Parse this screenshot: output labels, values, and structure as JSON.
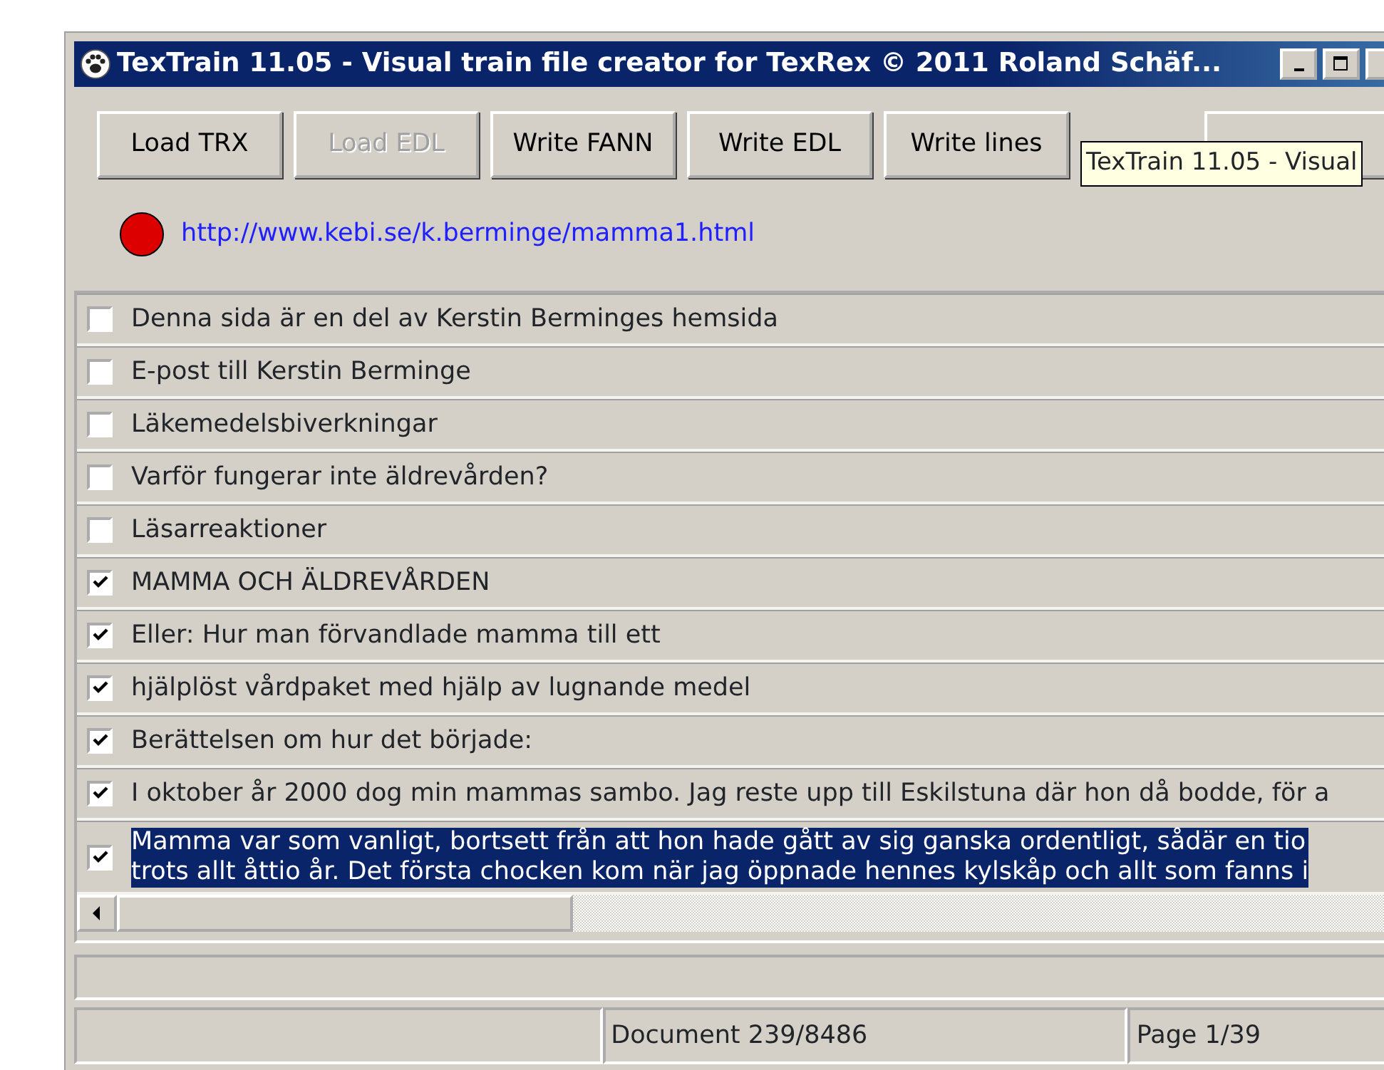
{
  "window": {
    "title": "TexTrain 11.05 - Visual train file creator for TexRex © 2011 Roland Schäf..."
  },
  "toolbar": [
    {
      "label": "Load TRX",
      "disabled": false
    },
    {
      "label": "Load EDL",
      "disabled": true
    },
    {
      "label": "Write FANN",
      "disabled": false
    },
    {
      "label": "Write EDL",
      "disabled": false
    },
    {
      "label": "Write lines",
      "disabled": false
    }
  ],
  "tooltip": "TexTrain 11.05 - Visual",
  "status_light": {
    "color": "#dd0000"
  },
  "url": "http://www.kebi.se/k.berminge/mamma1.html",
  "lines": [
    {
      "text": "Denna sida är en del av Kerstin Berminges hemsida",
      "checked": false,
      "selected": false
    },
    {
      "text": "E-post till Kerstin Berminge",
      "checked": false,
      "selected": false
    },
    {
      "text": "Läkemedelsbiverkningar",
      "checked": false,
      "selected": false
    },
    {
      "text": "Varför fungerar inte äldrevården?",
      "checked": false,
      "selected": false
    },
    {
      "text": "Läsarreaktioner",
      "checked": false,
      "selected": false
    },
    {
      "text": "MAMMA OCH ÄLDREVÅRDEN",
      "checked": true,
      "selected": false
    },
    {
      "text": "Eller: Hur man förvandlade mamma till ett",
      "checked": true,
      "selected": false
    },
    {
      "text": "hjälplöst vårdpaket med hjälp av lugnande medel",
      "checked": true,
      "selected": false
    },
    {
      "text": "Berättelsen om hur det började:",
      "checked": true,
      "selected": false
    },
    {
      "text": "I oktober år 2000 dog min mammas sambo. Jag reste upp till Eskilstuna där hon då bodde, för a",
      "checked": true,
      "selected": false
    },
    {
      "text": "Mamma var som vanligt, bortsett från att hon hade gått av sig ganska ordentligt, sådär en tio\ntrots allt åttio år. Det första chocken kom när jag öppnade hennes kylskåp och allt som fanns i",
      "checked": true,
      "selected": true
    }
  ],
  "status_bar": {
    "document": "Document 239/8486",
    "page": "Page 1/39"
  }
}
